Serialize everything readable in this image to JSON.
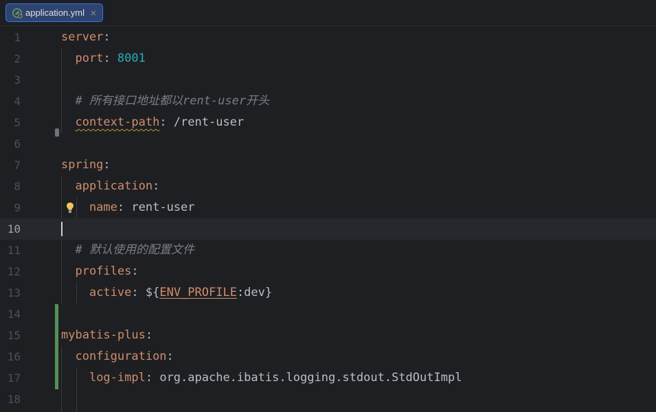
{
  "tab": {
    "icon": "spring-leaf-icon",
    "label": "application.yml",
    "close": "×"
  },
  "editor": {
    "line_numbers": [
      "1",
      "2",
      "3",
      "4",
      "5",
      "6",
      "7",
      "8",
      "9",
      "10",
      "11",
      "12",
      "13",
      "14",
      "15",
      "16",
      "17",
      "18"
    ],
    "current_line": "10",
    "lines": {
      "l1": {
        "key": "server",
        "colon": ":"
      },
      "l2": {
        "key": "port",
        "colon": ": ",
        "value": "8001"
      },
      "l4": {
        "comment": "# 所有接口地址都以rent-user开头"
      },
      "l5": {
        "key": "context-path",
        "colon": ": ",
        "value": "/rent-user"
      },
      "l7": {
        "key": "spring",
        "colon": ":"
      },
      "l8": {
        "key": "application",
        "colon": ":"
      },
      "l9": {
        "key": "name",
        "colon": ": ",
        "value": "rent-user"
      },
      "l11": {
        "comment": "# 默认使用的配置文件"
      },
      "l12": {
        "key": "profiles",
        "colon": ":"
      },
      "l13": {
        "key": "active",
        "colon": ": ",
        "value_prefix": "${",
        "env_var": "ENV_PROFILE",
        "value_suffix": ":dev}"
      },
      "l15": {
        "key": "mybatis-plus",
        "colon": ":"
      },
      "l16": {
        "key": "configuration",
        "colon": ":"
      },
      "l17": {
        "key": "log-impl",
        "colon": ": ",
        "value": "org.apache.ibatis.logging.stdout.StdOutImpl"
      }
    },
    "gutter_icons": [
      "lightbulb-icon",
      "fold-marker-icon"
    ],
    "colors": {
      "background": "#1e1f22",
      "key": "#cf8e6d",
      "number": "#2aacb8",
      "comment": "#7a7e85",
      "text": "#bcbec4",
      "change_bar": "#549159",
      "tab_active": "#2e436e"
    }
  }
}
